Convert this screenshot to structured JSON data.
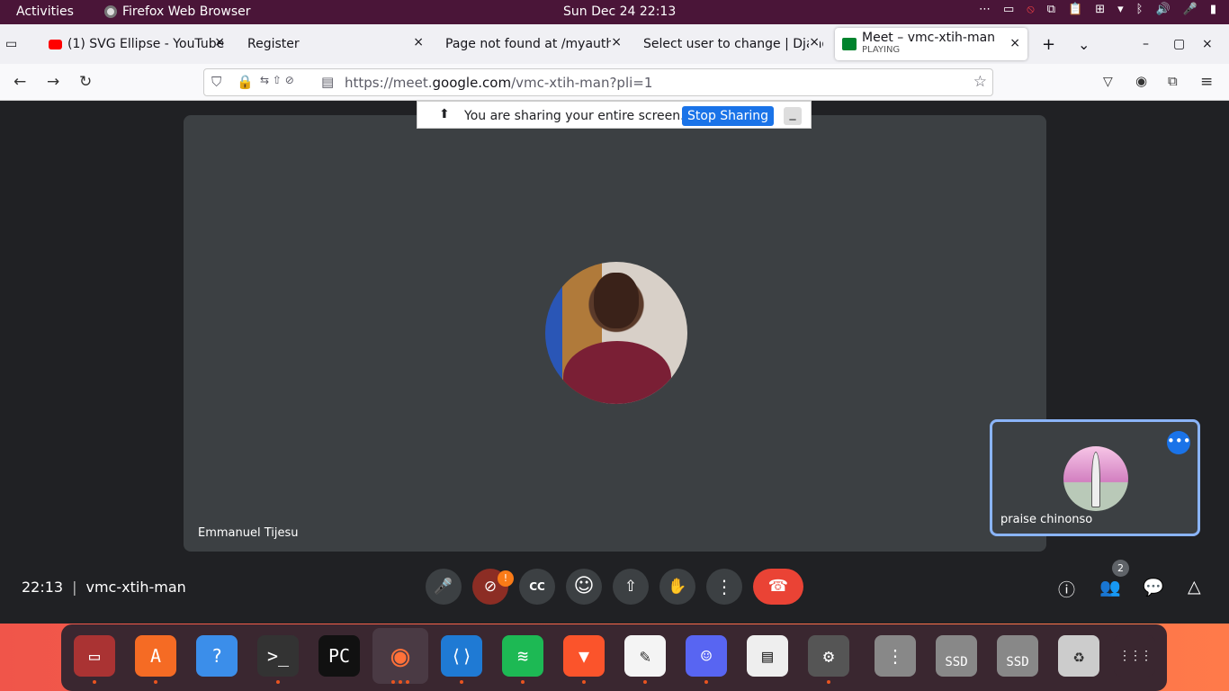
{
  "topbar": {
    "activities": "Activities",
    "app": "Firefox Web Browser",
    "clock": "Sun Dec 24  22:13",
    "tray": [
      "⋯",
      "▭",
      "⦸",
      "⧉",
      "📋",
      "⊞",
      "▾",
      "ᛒ",
      "🔊",
      "🎤",
      "▮"
    ]
  },
  "tabs": [
    {
      "title": "(1) SVG Ellipse - YouTube",
      "close": "×"
    },
    {
      "title": "Register",
      "close": "×"
    },
    {
      "title": "Page not found at /myauth/",
      "close": "×"
    },
    {
      "title": "Select user to change | Django",
      "close": "×"
    },
    {
      "title": "Meet – vmc-xtih-man",
      "subtitle": "PLAYING",
      "close": "×"
    }
  ],
  "tabbar": {
    "new": "+",
    "list": "⌄",
    "min": "–",
    "max": "▢",
    "close": "×"
  },
  "nav": {
    "back": "←",
    "forward": "→",
    "reload": "↻"
  },
  "url": {
    "prefix": "https://meet.",
    "domain": "google.com",
    "suffix": "/vmc-xtih-man?pli=1"
  },
  "share": {
    "text": "You are sharing your entire screen.",
    "stop": "Stop Sharing",
    "min": "_"
  },
  "meeting": {
    "presenter": "Emmanuel Tijesu",
    "self": "praise chinonso",
    "time": "22:13",
    "sep": "|",
    "code": "vmc-xtih-man",
    "participants": "2",
    "badge": "!"
  },
  "controls": {
    "mic": "🎤",
    "cam": "⊘",
    "cc": "CC",
    "emoji": "☺",
    "present": "⇧",
    "hand": "✋",
    "more": "⋮",
    "leave": "☎",
    "info": "ⓘ",
    "people": "👥",
    "chat": "💬",
    "activities": "△"
  },
  "colors": {
    "topbar": "#4a1538",
    "accent": "#1a73e8",
    "leave": "#ea4335",
    "tile": "#3c4043",
    "selfborder": "#8ab4f8"
  },
  "dock": [
    {
      "name": "files",
      "label": "▭",
      "color": "#a33"
    },
    {
      "name": "app-center",
      "label": "A",
      "color": "#f56b24"
    },
    {
      "name": "help",
      "label": "?",
      "color": "#3b8eea"
    },
    {
      "name": "terminal",
      "label": ">_",
      "color": "#333"
    },
    {
      "name": "pycharm",
      "label": "PC",
      "color": "#111"
    },
    {
      "name": "firefox",
      "label": "◉",
      "color": "#ff7139"
    },
    {
      "name": "vscode",
      "label": "⟨⟩",
      "color": "#1f7ad4"
    },
    {
      "name": "spotify",
      "label": "≋",
      "color": "#1db954"
    },
    {
      "name": "brave",
      "label": "▼",
      "color": "#fb542b"
    },
    {
      "name": "text-editor",
      "label": "✎",
      "color": "#f4f4f4"
    },
    {
      "name": "discord",
      "label": "☺",
      "color": "#5865f2"
    },
    {
      "name": "document-viewer",
      "label": "▤",
      "color": "#eee"
    },
    {
      "name": "settings",
      "label": "⚙",
      "color": "#555"
    },
    {
      "name": "disk-1",
      "label": "⋮",
      "color": "#888"
    },
    {
      "name": "ssd-1",
      "label": "SSD",
      "color": "#888"
    },
    {
      "name": "ssd-2",
      "label": "SSD",
      "color": "#888"
    },
    {
      "name": "trash",
      "label": "♻",
      "color": "#ccc"
    },
    {
      "name": "app-grid",
      "label": "⋮⋮⋮",
      "color": "#3a2730"
    }
  ]
}
